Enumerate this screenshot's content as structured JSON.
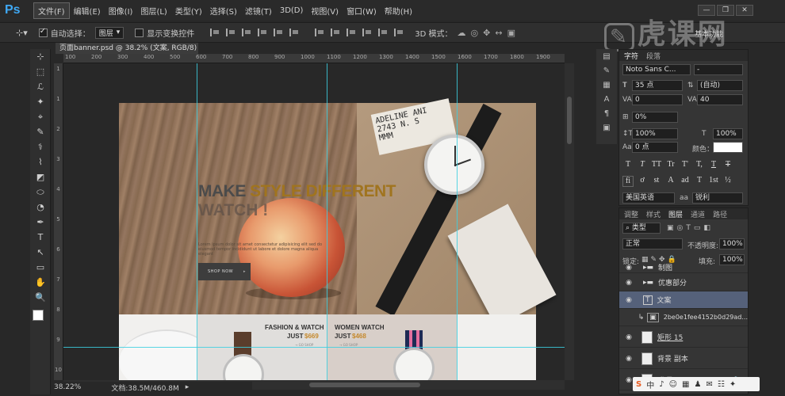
{
  "app": {
    "logo": "Ps"
  },
  "menu": [
    "文件(F)",
    "编辑(E)",
    "图像(I)",
    "图层(L)",
    "类型(Y)",
    "选择(S)",
    "滤镜(T)",
    "3D(D)",
    "视图(V)",
    "窗口(W)",
    "帮助(H)"
  ],
  "window_controls": [
    "—",
    "❐",
    "✕"
  ],
  "options_bar": {
    "auto_select_label": "自动选择：",
    "auto_select_value": "图层",
    "show_transform_label": "显示变换控件",
    "mode_3d_label": "3D 模式："
  },
  "doc_tab": "页面banner.psd @ 38.2% (文案, RGB/8) *",
  "ruler_h": [
    "100",
    "200",
    "300",
    "400",
    "500",
    "600",
    "700",
    "800",
    "900",
    "1000",
    "1100",
    "1200",
    "1300",
    "1400",
    "1500",
    "1600",
    "1700",
    "1800",
    "1900"
  ],
  "ruler_v": [
    "1",
    "1",
    "2",
    "3",
    "4",
    "5",
    "6",
    "7",
    "8",
    "9",
    "10"
  ],
  "tools": [
    "⊹",
    "⬚",
    "ℒ",
    "✦",
    "⌖",
    "✎",
    "⚕",
    "⌇",
    "◩",
    "⬭",
    "◔",
    "✒",
    "T",
    "↖",
    "▭",
    "✋",
    "🔍"
  ],
  "canvas": {
    "card_lines": [
      "ADELINE ANI",
      "2743 N. S",
      "MMM"
    ],
    "headline_a": "MAKE ",
    "headline_b": "STYLE DIFFERENT",
    "headline2": "WATCH !",
    "description": "Lorem ipsum dolor sit amet consectetur adipisicing elit sed do eiusmod tempor incididunt ut labore et dolore magna aliqua elegant",
    "shop_label": "SHOP NOW",
    "panel1_title": "FASHION & WATCH",
    "panel1_price_prefix": "JUST ",
    "panel1_price": "$669",
    "panel1_small": "→ GO SHOP",
    "panel2_title": "WOMEN WATCH",
    "panel2_price_prefix": "JUST ",
    "panel2_price": "$468",
    "panel2_small": "→ GO SHOP",
    "accent_color": "#a0741f",
    "price_color": "#c5892d"
  },
  "status": {
    "zoom": "38.22%",
    "doc_size": "文档:38.5M/460.8M"
  },
  "character_panel": {
    "tabs": [
      "字符",
      "段落"
    ],
    "font_family": "Noto Sans C...",
    "font_style": "-",
    "font_size": "35 点",
    "leading": "(自动)",
    "kerning": "0",
    "tracking": "40",
    "vscale_pct": "0%",
    "vertical_scale": "100%",
    "horizontal_scale": "100%",
    "baseline_shift": "0 点",
    "color_label": "颜色：",
    "style_buttons": [
      "T",
      "T",
      "TT",
      "Tr",
      "T'",
      "T,",
      "T",
      "T"
    ],
    "opentype_buttons": [
      "fi",
      "ơ",
      "st",
      "A",
      "ad",
      "T",
      "1st",
      "½"
    ],
    "language": "美国英语",
    "antialias_a": "aa",
    "antialias": "锐利"
  },
  "layers_panel": {
    "tabs": [
      "调整",
      "样式",
      "图层",
      "通道",
      "路径"
    ],
    "filter": "类型",
    "blend_mode": "正常",
    "opacity_label": "不透明度:",
    "opacity": "100%",
    "lock_label": "锁定:",
    "fill_label": "填充:",
    "fill": "100%",
    "layers": [
      {
        "name": "制图",
        "type": "group"
      },
      {
        "name": "优惠部分",
        "type": "group"
      },
      {
        "name": "文案",
        "type": "group"
      },
      {
        "name": "2be0e1fee4152b0d29ad...",
        "type": "smart"
      },
      {
        "name": "矩形 15",
        "type": "shape"
      },
      {
        "name": "背景 副本",
        "type": "pixel"
      },
      {
        "name": "背景",
        "type": "pixel"
      }
    ]
  },
  "watermark": "虎课网",
  "panel_title": "基本功能",
  "tray_icons": [
    "S",
    "中",
    "♪",
    "☺",
    "▦",
    "♟",
    "✉",
    "☷",
    "✦"
  ]
}
